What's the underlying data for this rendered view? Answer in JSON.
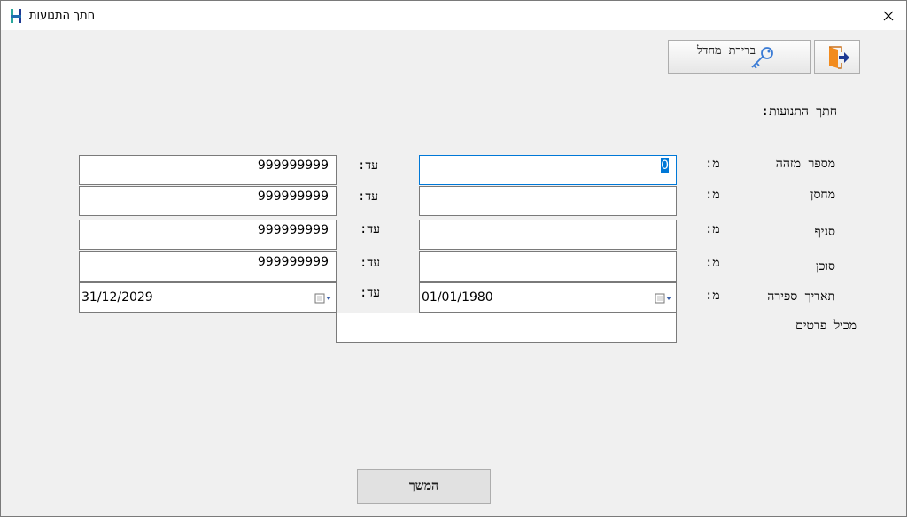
{
  "window": {
    "title": "חתך התנועות"
  },
  "toolbar": {
    "user_select_label": "ברירת מחדל"
  },
  "section": {
    "title": "חתך התנועות:"
  },
  "labels": {
    "from": "מ:",
    "to": "עד:"
  },
  "rows": [
    {
      "label": "מספר מזהה",
      "from_value": "0",
      "to_value": "999999999"
    },
    {
      "label": "מחסן",
      "from_value": "",
      "to_value": "999999999"
    },
    {
      "label": "סניף",
      "from_value": "",
      "to_value": "999999999"
    },
    {
      "label": "סוכן",
      "from_value": "",
      "to_value": "999999999"
    },
    {
      "label": "תאריך ספירה",
      "from_value": "01/01/1980",
      "to_value": "31/12/2029"
    }
  ],
  "contains_items": {
    "label": "מכיל פרטים",
    "value": ""
  },
  "continue_button": {
    "label": "המשך"
  },
  "colors": {
    "accent": "#0078d7",
    "icon_teal": "#2aa79b",
    "icon_navy": "#1f3a93"
  }
}
